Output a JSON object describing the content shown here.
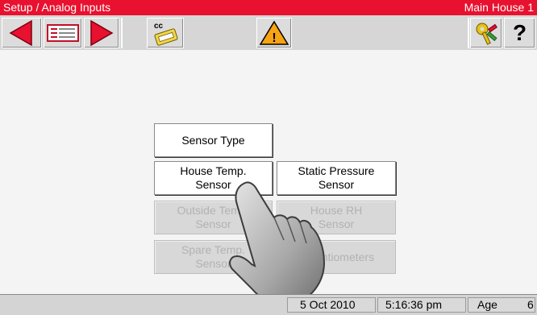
{
  "titlebar": {
    "breadcrumb": "Setup / Analog Inputs",
    "location": "Main House 1",
    "color": "#e8112f"
  },
  "toolbar": {
    "icons": [
      "back-arrow-icon",
      "menu-list-icon",
      "forward-arrow-icon",
      "cc-keys-icon",
      "warning-icon",
      "key-icon",
      "help-icon"
    ],
    "help_glyph": "?",
    "cc_label": "cc",
    "warning_glyph": "!",
    "accent_red": "#e8112f"
  },
  "menu": {
    "sensor_type": "Sensor Type",
    "house_temp": "House Temp.\nSensor",
    "static_pressure": "Static Pressure\nSensor",
    "outside_temp": "Outside Temp.\nSensor",
    "house_rh": "House RH\nSensor",
    "spare_temp": "Spare Temp.\nSensor",
    "potentiometers": "Potentiometers"
  },
  "status": {
    "date": "5 Oct 2010",
    "time": "5:16:36 pm",
    "age_label": "Age",
    "age_value": "6"
  }
}
